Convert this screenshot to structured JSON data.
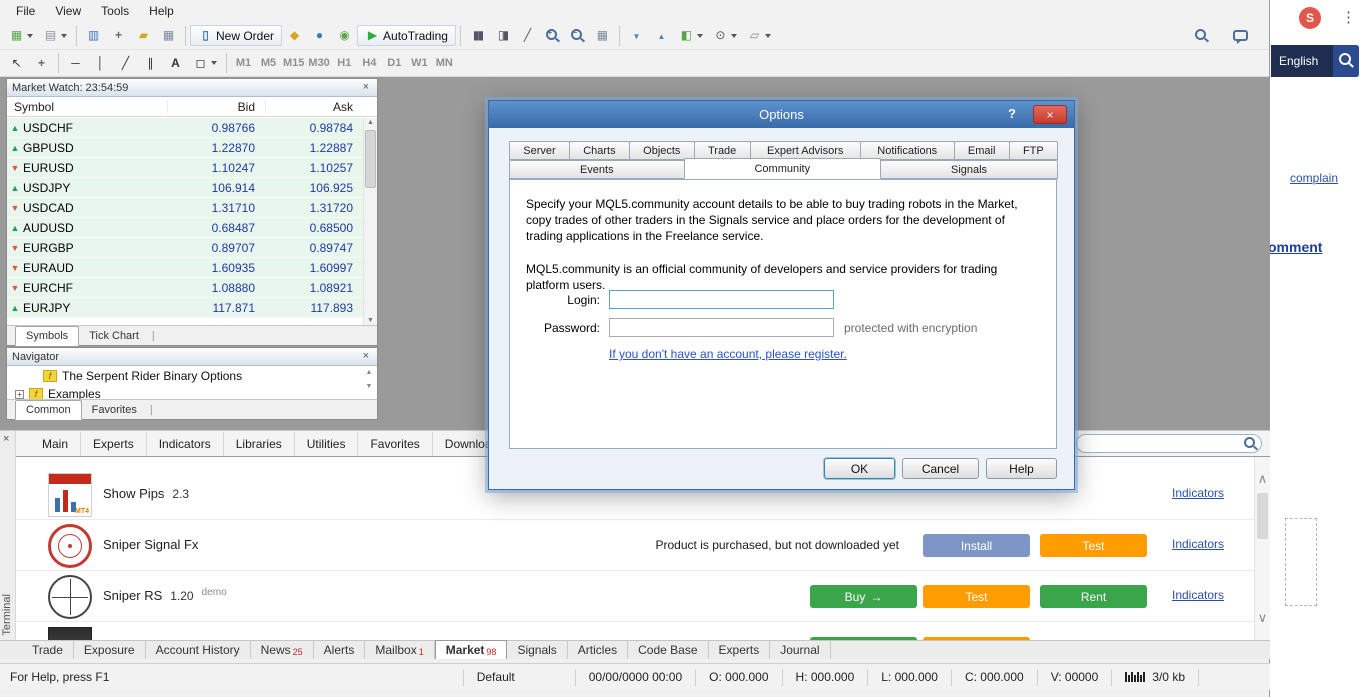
{
  "menubar": {
    "items": [
      "File",
      "View",
      "Tools",
      "Help"
    ]
  },
  "toolbar": {
    "new_order": "New Order",
    "autotrading": "AutoTrading",
    "timeframes": [
      "M1",
      "M5",
      "M15",
      "M30",
      "H1",
      "H4",
      "D1",
      "W1",
      "MN"
    ]
  },
  "market_watch": {
    "title": "Market Watch: 23:54:59",
    "columns": {
      "symbol": "Symbol",
      "bid": "Bid",
      "ask": "Ask"
    },
    "rows": [
      {
        "symbol": "USDCHF",
        "bid": "0.98766",
        "ask": "0.98784",
        "direction": "up"
      },
      {
        "symbol": "GBPUSD",
        "bid": "1.22870",
        "ask": "1.22887",
        "direction": "up"
      },
      {
        "symbol": "EURUSD",
        "bid": "1.10247",
        "ask": "1.10257",
        "direction": "down"
      },
      {
        "symbol": "USDJPY",
        "bid": "106.914",
        "ask": "106.925",
        "direction": "up"
      },
      {
        "symbol": "USDCAD",
        "bid": "1.31710",
        "ask": "1.31720",
        "direction": "down"
      },
      {
        "symbol": "AUDUSD",
        "bid": "0.68487",
        "ask": "0.68500",
        "direction": "up"
      },
      {
        "symbol": "EURGBP",
        "bid": "0.89707",
        "ask": "0.89747",
        "direction": "down"
      },
      {
        "symbol": "EURAUD",
        "bid": "1.60935",
        "ask": "1.60997",
        "direction": "down"
      },
      {
        "symbol": "EURCHF",
        "bid": "1.08880",
        "ask": "1.08921",
        "direction": "down"
      },
      {
        "symbol": "EURJPY",
        "bid": "117.871",
        "ask": "117.893",
        "direction": "up"
      }
    ],
    "tabs": [
      "Symbols",
      "Tick Chart"
    ]
  },
  "navigator": {
    "title": "Navigator",
    "items": [
      "The Serpent Rider Binary Options",
      "Examples"
    ],
    "tabs": [
      "Common",
      "Favorites"
    ]
  },
  "options_dialog": {
    "title": "Options",
    "tabs_row1": [
      "Server",
      "Charts",
      "Objects",
      "Trade",
      "Expert Advisors",
      "Notifications",
      "Email",
      "FTP"
    ],
    "tabs_row2": [
      "Events",
      "Community",
      "Signals"
    ],
    "active_tab": "Community",
    "description": "Specify your MQL5.community account details to be able to buy trading robots in the Market, copy trades of other traders in the Signals service and place orders for the development of trading applications in the Freelance service.",
    "community_note": "MQL5.community is an official community of developers and service providers for trading platform users.",
    "login_label": "Login:",
    "password_label": "Password:",
    "password_note": "protected with encryption",
    "register_link": "If you don't have an account, please register.",
    "ok": "OK",
    "cancel": "Cancel",
    "help": "Help"
  },
  "terminal": {
    "side_label": "Terminal",
    "top_tabs": [
      "Main",
      "Experts",
      "Indicators",
      "Libraries",
      "Utilities",
      "Favorites",
      "Downloads"
    ],
    "products": [
      {
        "name": "Show Pips",
        "version": "2.3",
        "link": "Indicators"
      },
      {
        "name": "Sniper Signal Fx",
        "status": "Product is purchased, but not downloaded yet",
        "install": "Install",
        "test": "Test",
        "link": "Indicators"
      },
      {
        "name": "Sniper RS",
        "version": "1.20",
        "demo": "demo",
        "buy": "Buy",
        "test": "Test",
        "rent": "Rent",
        "link": "Indicators"
      }
    ],
    "bottom_tabs": [
      {
        "label": "Trade",
        "badge": ""
      },
      {
        "label": "Exposure",
        "badge": ""
      },
      {
        "label": "Account History",
        "badge": ""
      },
      {
        "label": "News",
        "badge": "25"
      },
      {
        "label": "Alerts",
        "badge": ""
      },
      {
        "label": "Mailbox",
        "badge": "1"
      },
      {
        "label": "Market",
        "badge": "98"
      },
      {
        "label": "Signals",
        "badge": ""
      },
      {
        "label": "Articles",
        "badge": ""
      },
      {
        "label": "Code Base",
        "badge": ""
      },
      {
        "label": "Experts",
        "badge": ""
      },
      {
        "label": "Journal",
        "badge": ""
      }
    ]
  },
  "statusbar": {
    "help": "For Help, press F1",
    "profile": "Default",
    "datetime": "00/00/0000 00:00",
    "open": "O: 000.000",
    "high": "H: 000.000",
    "low": "L: 000.000",
    "close": "C: 000.000",
    "volume": "V: 00000",
    "traffic": "3/0 kb"
  },
  "background_window": {
    "avatar": "S",
    "language": "English",
    "complain_link": "complain",
    "comment_text": "omment"
  },
  "icons": {
    "help": "?",
    "close": "×",
    "kebab": "⋮",
    "arrow_right": "→"
  },
  "colors": {
    "accent_blue": "#3c7fb1",
    "buy_green": "#3aa54a",
    "test_orange": "#ff9c00",
    "install_blue": "#7e96c6",
    "titlebar_blue": "#4a7ebc",
    "close_red": "#c83a2c"
  }
}
